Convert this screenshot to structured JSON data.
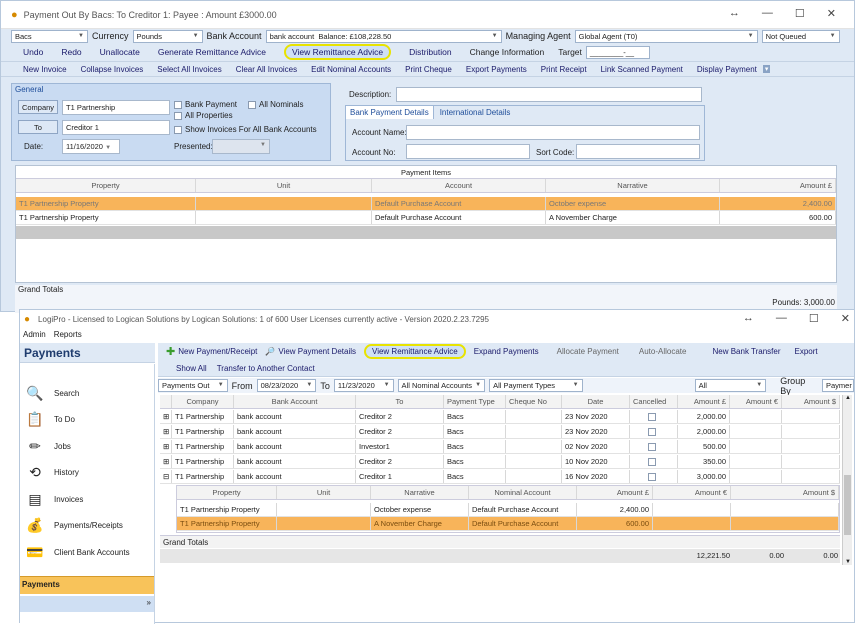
{
  "win1": {
    "title": "Payment Out By Bacs: To Creditor 1: Payee : Amount £3000.00",
    "winbtns": [
      "↔",
      "—",
      "☐",
      "✕"
    ],
    "method": "Bacs",
    "currency_label": "Currency",
    "currency": "Pounds",
    "bank_account_label": "Bank Account",
    "bank_account": "bank account",
    "balance": "Balance: £108,228.50",
    "managing_agent_label": "Managing Agent",
    "managing_agent": "Global Agent (T0)",
    "status": "Not Queued",
    "toolbar1": [
      "Undo",
      "Redo",
      "Unallocate",
      "Generate Remittance Advice",
      "View Remittance Advice",
      "Distribution",
      "Change Information"
    ],
    "target_label": "Target",
    "target_value": "________-__",
    "toolbar2": [
      "New Invoice",
      "Collapse Invoices",
      "Select All Invoices",
      "Clear All Invoices",
      "Edit Nominal Accounts",
      "Print Cheque",
      "Export Payments",
      "Print Receipt",
      "Link Scanned Payment",
      "Display Payment"
    ],
    "general": {
      "title": "General",
      "company_btn": "Company",
      "company": "T1 Partnership",
      "to_btn": "To",
      "to": "Creditor 1",
      "date_label": "Date:",
      "date": "11/16/2020",
      "presented_label": "Presented:",
      "bank_payment": "Bank Payment",
      "all_nominals": "All Nominals",
      "all_properties": "All Properties",
      "show_invoices": "Show Invoices For All Bank Accounts"
    },
    "description_label": "Description:",
    "tabs": [
      "Bank Payment Details",
      "International Details"
    ],
    "account_name_label": "Account Name:",
    "account_no_label": "Account No:",
    "sort_code_label": "Sort Code:",
    "payment_items": {
      "title": "Payment Items",
      "columns": [
        "Property",
        "Unit",
        "Account",
        "Narrative",
        "Amount £"
      ],
      "rows": [
        [
          "T1 Partnership Property",
          "",
          "Default Purchase Account",
          "October expense",
          "2,400.00"
        ],
        [
          "T1 Partnership Property",
          "",
          "Default Purchase Account",
          "A November Charge",
          "600.00"
        ]
      ]
    },
    "grand_totals": "Grand Totals",
    "pounds_total": "Pounds: 3,000.00"
  },
  "win2": {
    "title": "LogiPro - Licensed to Logican Solutions by Logican Solutions: 1 of 600 User Licenses currently active - Version 2020.2.23.7295",
    "winbtns": [
      "↔",
      "—",
      "☐",
      "✕"
    ],
    "menu": [
      "Admin",
      "Reports"
    ],
    "section": "Payments",
    "toolbar1": [
      "New Payment/Receipt",
      "View Payment Details",
      "View Remittance Advice",
      "Expand Payments",
      "Allocate Payment",
      "Auto-Allocate",
      "New Bank Transfer",
      "Export"
    ],
    "toolbar2": [
      "Show All",
      "Transfer to Another Contact"
    ],
    "filters": {
      "type": "Payments Out",
      "from_label": "From",
      "from": "08/23/2020",
      "to_label": "To",
      "to": "11/23/2020",
      "nominal": "All Nominal Accounts",
      "payment_types": "All Payment Types",
      "all": "All",
      "group_by": "Group By",
      "group_val": "Paymer"
    },
    "nav": [
      "Search",
      "To Do",
      "Jobs",
      "History",
      "Invoices",
      "Payments/Receipts",
      "Client Bank Accounts"
    ],
    "nav_footer": "Payments",
    "columns": [
      "Company",
      "Bank Account",
      "To",
      "Payment Type",
      "Cheque No",
      "Date",
      "Cancelled",
      "Amount £",
      "Amount €",
      "Amount $"
    ],
    "rows": [
      [
        "T1 Partnership",
        "bank account",
        "Creditor 2",
        "Bacs",
        "",
        "23 Nov 2020",
        "",
        "2,000.00",
        "",
        ""
      ],
      [
        "T1 Partnership",
        "bank account",
        "Creditor 2",
        "Bacs",
        "",
        "23 Nov 2020",
        "",
        "2,000.00",
        "",
        ""
      ],
      [
        "T1 Partnership",
        "bank account",
        "Investor1",
        "Bacs",
        "",
        "02 Nov 2020",
        "",
        "500.00",
        "",
        ""
      ],
      [
        "T1 Partnership",
        "bank account",
        "Creditor 2",
        "Bacs",
        "",
        "10 Nov 2020",
        "",
        "350.00",
        "",
        ""
      ],
      [
        "T1 Partnership",
        "bank account",
        "Creditor 1",
        "Bacs",
        "",
        "16 Nov 2020",
        "",
        "3,000.00",
        "",
        ""
      ]
    ],
    "sub_columns": [
      "Property",
      "Unit",
      "Narrative",
      "Nominal Account",
      "Amount £",
      "Amount €",
      "Amount $"
    ],
    "sub_rows": [
      [
        "T1 Partnership Property",
        "",
        "October expense",
        "Default Purchase Account",
        "2,400.00",
        "",
        ""
      ],
      [
        "T1 Partnership Property",
        "",
        "A November Charge",
        "Default Purchase Account",
        "600.00",
        "",
        ""
      ]
    ],
    "grand_totals": "Grand Totals",
    "totals": [
      "12,221.50",
      "0.00",
      "0.00"
    ]
  }
}
